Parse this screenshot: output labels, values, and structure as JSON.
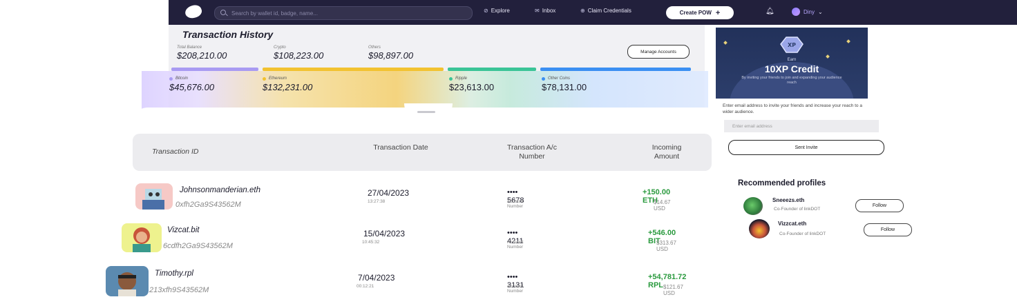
{
  "topbar": {
    "search_placeholder": "Search by wallet id, badge, name...",
    "nav": [
      {
        "label": "Explore",
        "icon": "compass-icon"
      },
      {
        "label": "Inbox",
        "icon": "inbox-icon"
      },
      {
        "label": "Claim Credentials",
        "icon": "credential-icon"
      }
    ],
    "create_label": "Create POW",
    "user_name": "Diny"
  },
  "history": {
    "title": "Transaction History",
    "balances": [
      {
        "label": "Total Balance",
        "value": "$208,210.00"
      },
      {
        "label": "Crypto",
        "value": "$108,223.00"
      },
      {
        "label": "Others",
        "value": "$98,897.00"
      }
    ],
    "manage_label": "Manage Accounts",
    "coins": [
      {
        "label": "Bitcoin",
        "value": "$45,676.00",
        "color": "#a99bf2"
      },
      {
        "label": "Ethereum",
        "value": "$132,231.00",
        "color": "#f2c230"
      },
      {
        "label": "Ripple",
        "value": "$23,613.00",
        "color": "#3bc497"
      },
      {
        "label": "Other Coins",
        "value": "$78,131.00",
        "color": "#3b8ff2"
      }
    ],
    "headers": {
      "id": "Transaction ID",
      "date": "Transaction Date",
      "account": "Transaction A/c Number",
      "amount": "Incoming Amount"
    },
    "rows": [
      {
        "name": "Johnsonmanderian.eth",
        "hash": "0xfh2Ga9S43562M",
        "date": "27/04/2023",
        "time": "13:27:38",
        "account": "•••• 5678",
        "account_label": "Account Number",
        "amount": "+150.00 ETH",
        "usd": "$14.67 USD"
      },
      {
        "name": "Vizcat.bit",
        "hash": "6cdfh2Ga9S43562M",
        "date": "15/04/2023",
        "time": "10:45:32",
        "account": "•••• 4211",
        "account_label": "Account Number",
        "amount": "+546.00 BIT",
        "usd": "$313.67 USD"
      },
      {
        "name": "Timothy.rpl",
        "hash": "213xfh9S43562M",
        "date": "7/04/2023",
        "time": "00:12:21",
        "account": "•••• 3131",
        "account_label": "Account Number",
        "amount": "+54,781.72 RPL",
        "usd": "$121.67 USD"
      }
    ]
  },
  "sidebar": {
    "promo_badge": "XP",
    "promo_earn": "Earn",
    "promo_title": "10XP Credit",
    "promo_sub": "By inviting your friends to join and expanding your audience reach",
    "invite_text": "Enter email address to invite your friends and increase your reach to a wider audience.",
    "email_placeholder": "Enter email address",
    "sent_label": "Sent Invite",
    "rec_title": "Recommended profiles",
    "profiles": [
      {
        "name": "Sneeezs.eth",
        "role": "Co-Founder of linkDOT",
        "follow": "Follow"
      },
      {
        "name": "Vizzcat.eth",
        "role": "Co-Founder of linkDOT",
        "follow": "Follow"
      }
    ]
  }
}
